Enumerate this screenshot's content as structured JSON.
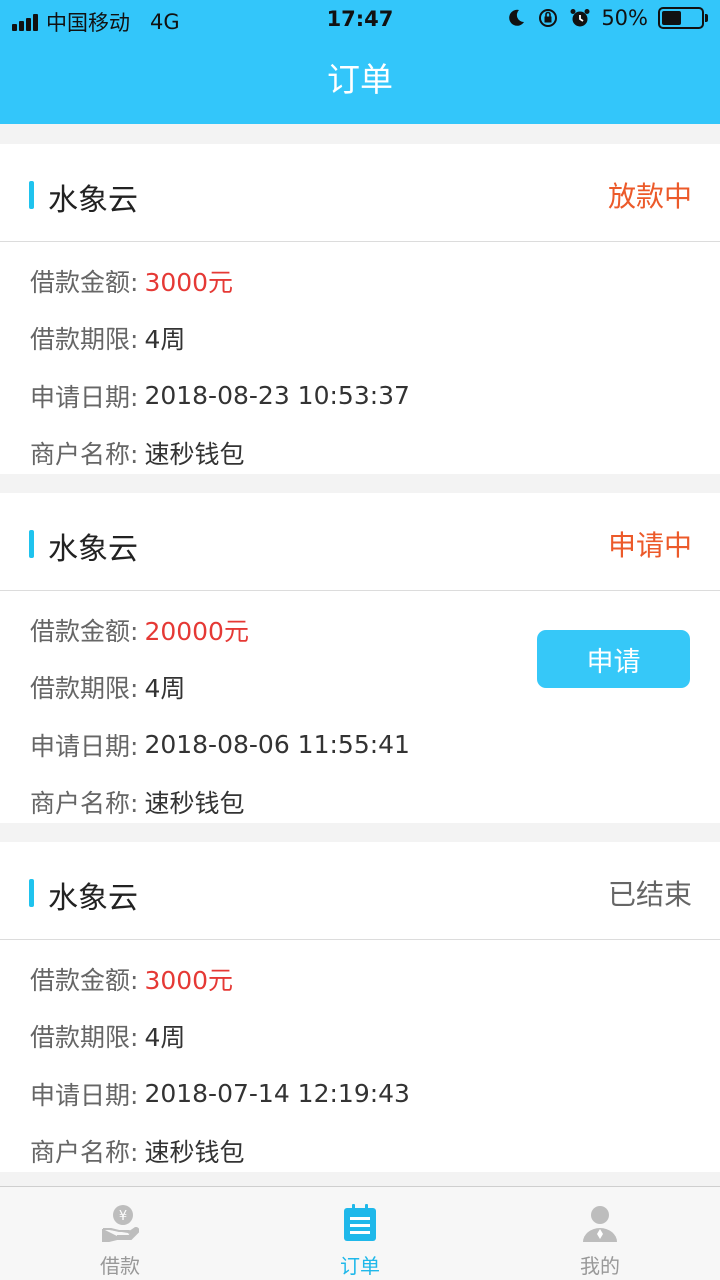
{
  "status_bar": {
    "carrier": "中国移动",
    "network": "4G",
    "time": "17:47",
    "battery_text": "50%",
    "battery_level": 0.5
  },
  "nav": {
    "title": "订单"
  },
  "labels": {
    "amount": "借款金额:",
    "term": "借款期限:",
    "date": "申请日期:",
    "merchant": "商户名称:"
  },
  "orders": [
    {
      "name": "水象云",
      "status": "放款中",
      "amount": "3000元",
      "term": "4周",
      "date": "2018-08-23 10:53:37",
      "merchant": "速秒钱包"
    },
    {
      "name": "水象云",
      "status": "申请中",
      "amount": "20000元",
      "term": "4周",
      "date": "2018-08-06 11:55:41",
      "merchant": "速秒钱包",
      "action": "申请"
    },
    {
      "name": "水象云",
      "status": "已结束",
      "amount": "3000元",
      "term": "4周",
      "date": "2018-07-14 12:19:43",
      "merchant": "速秒钱包"
    }
  ],
  "tabs": [
    {
      "label": "借款",
      "icon": "loan-hand-icon"
    },
    {
      "label": "订单",
      "icon": "order-list-icon"
    },
    {
      "label": "我的",
      "icon": "profile-user-icon"
    }
  ],
  "colors": {
    "primary": "#33c6fa",
    "accent": "#1fc3ee",
    "status_active": "#ec5a2a",
    "money": "#e53935",
    "status_ended": "#666666"
  }
}
